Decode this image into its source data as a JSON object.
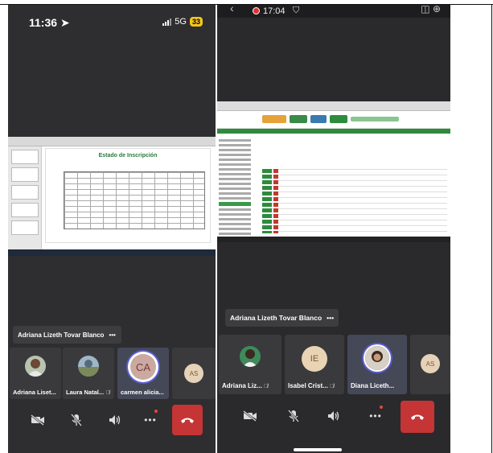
{
  "left_phone": {
    "time": "11:36",
    "network": "5G",
    "battery": "33",
    "slide_title": "Estado de Inscripción",
    "banner_name": "Adriana Lizeth Tovar Blanco",
    "participants": [
      {
        "name": "Adriana Liset...",
        "type": "photo"
      },
      {
        "name": "Laura Natal...",
        "type": "photo",
        "muted": true
      },
      {
        "name": "carmen alicia...",
        "type": "initials",
        "initials": "CA",
        "active": true
      },
      {
        "name": "",
        "type": "initials",
        "initials": "AS"
      }
    ]
  },
  "right_phone": {
    "time": "17:04",
    "banner_name": "Adriana Lizeth Tovar Blanco",
    "participants": [
      {
        "name": "Adriana Liz...",
        "type": "photo",
        "muted": true
      },
      {
        "name": "Isabel Crist...",
        "type": "initials",
        "initials": "IE",
        "muted": true
      },
      {
        "name": "Diana Liceth...",
        "type": "photo",
        "active": true
      },
      {
        "name": "",
        "type": "initials",
        "initials": "AS"
      }
    ]
  },
  "controls": [
    "camera-off",
    "mic-off",
    "speaker",
    "more",
    "leave-call"
  ],
  "colors": {
    "leave": "#c53535",
    "accent_ring": "#5a5fd0",
    "battery": "#f5c518",
    "brand_green": "#2e8b3e"
  }
}
